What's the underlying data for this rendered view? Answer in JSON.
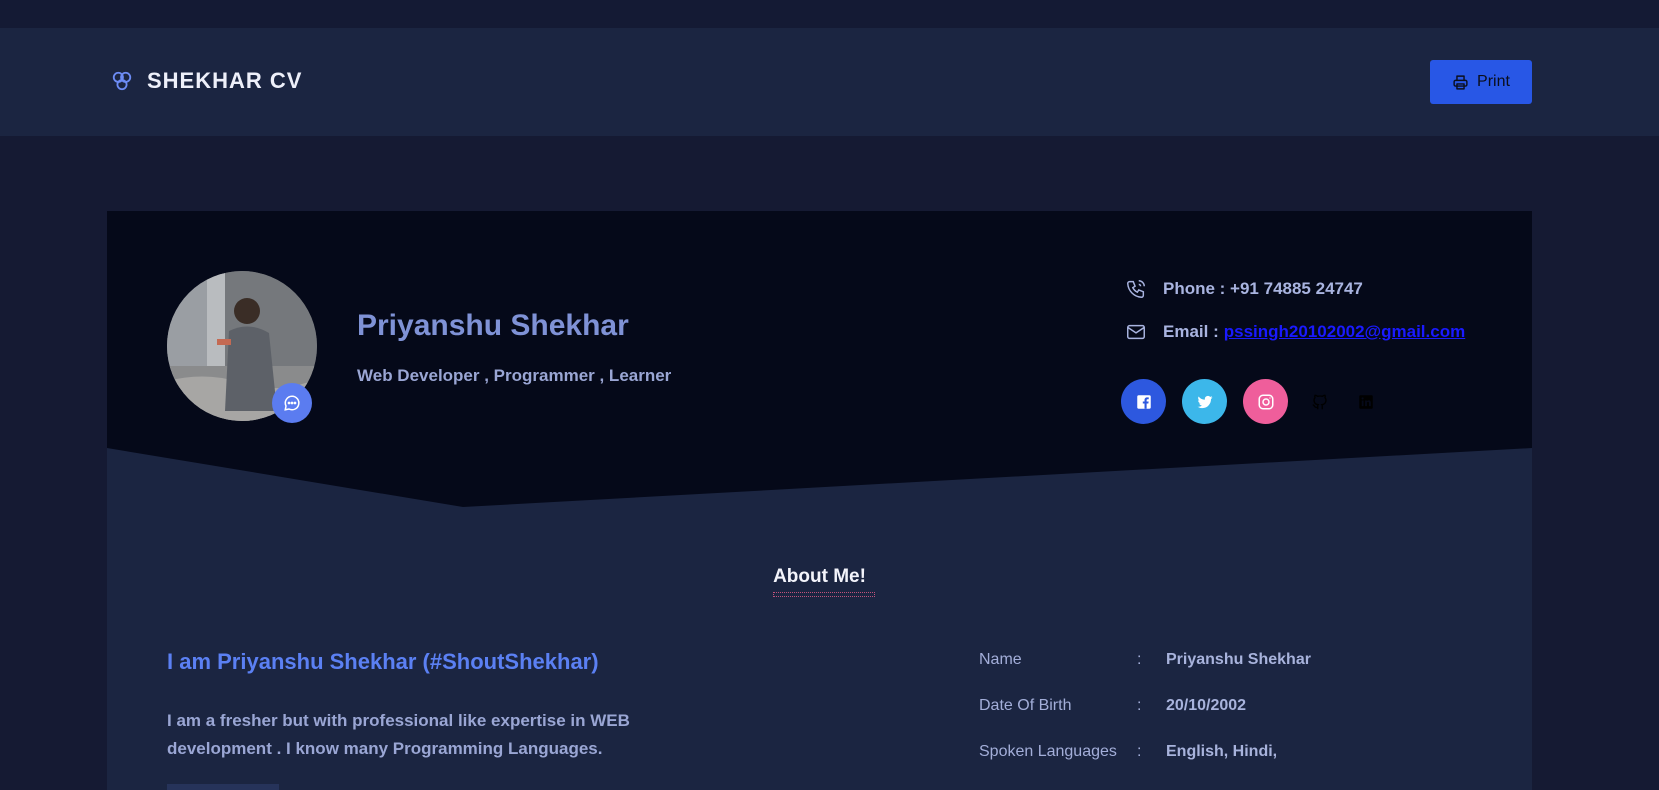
{
  "navbar": {
    "brand": "SHEKHAR CV",
    "print_label": "Print"
  },
  "hero": {
    "name": "Priyanshu Shekhar",
    "role": "Web Developer , Programmer , Learner",
    "phone_label": "Phone : +91 74885 24747",
    "email_label": "Email :",
    "email": "pssingh20102002@gmail.com",
    "socials": [
      "facebook-icon",
      "twitter-icon",
      "instagram-icon",
      "github-icon",
      "linkedin-icon"
    ]
  },
  "about": {
    "section_title": "About Me!",
    "intro_title": "I am Priyanshu Shekhar (#ShoutShekhar)",
    "intro_text": "I am a fresher but with professional like expertise in WEB development . I know many Programming Languages.",
    "info": [
      {
        "key": "Name",
        "sep": ":",
        "value": "Priyanshu Shekhar"
      },
      {
        "key": "Date Of Birth",
        "sep": ":",
        "value": "20/10/2002"
      },
      {
        "key": "Spoken Languages",
        "sep": ":",
        "value": "English, Hindi,"
      }
    ]
  },
  "colors": {
    "page_bg": "#151a33",
    "navbar_bg": "#1b2541",
    "hero_bg": "#050919",
    "accent": "#2857e6",
    "facebook": "#2d58df",
    "twitter": "#3cb7ea",
    "instagram": "#ef5e9b"
  }
}
